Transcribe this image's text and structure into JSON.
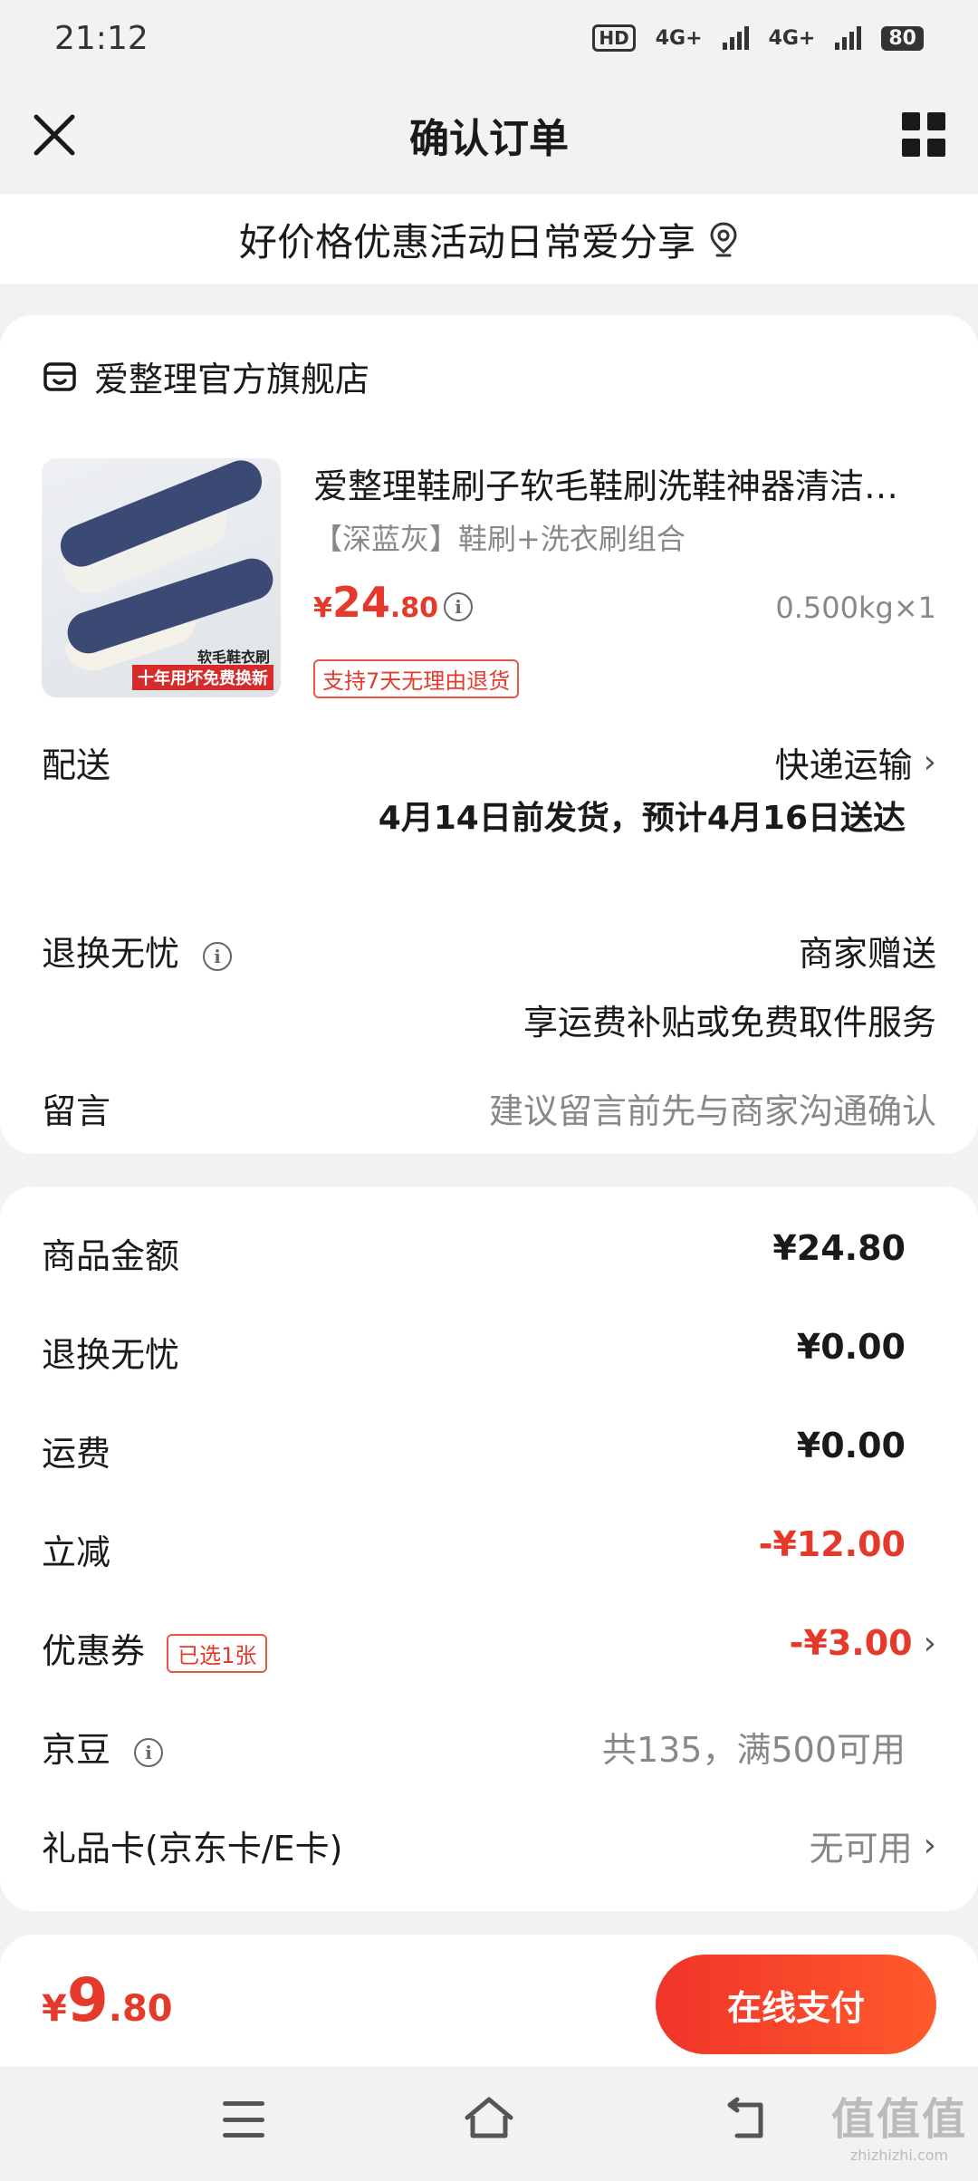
{
  "status_bar": {
    "time": "21:12",
    "hd": "HD",
    "net1": "4G+",
    "net2": "4G+",
    "battery": "80"
  },
  "header": {
    "title": "确认订单"
  },
  "promo_banner": {
    "text": "好价格优惠活动日常爱分享"
  },
  "store": {
    "name": "爱整理官方旗舰店"
  },
  "product": {
    "title": "爱整理鞋刷子软毛鞋刷洗鞋神器清洁…",
    "variant": "【深蓝灰】鞋刷+洗衣刷组合",
    "price_currency": "¥",
    "price_int": "24",
    "price_dec": ".80",
    "weight": "0.500kg×1",
    "badge": "支持7天无理由退货",
    "image_label_1": "软毛鞋衣刷",
    "image_label_2": "十年用坏免费换新"
  },
  "delivery": {
    "label": "配送",
    "method": "快递运输",
    "estimate": "4月14日前发货，预计4月16日送达"
  },
  "returns": {
    "label": "退换无忧",
    "value": "商家赠送",
    "desc": "享运费补贴或免费取件服务"
  },
  "message": {
    "label": "留言",
    "placeholder": "建议留言前先与商家沟通确认"
  },
  "summary": {
    "goods_label": "商品金额",
    "goods_value": "¥24.80",
    "returns_label": "退换无忧",
    "returns_value": "¥0.00",
    "shipping_label": "运费",
    "shipping_value": "¥0.00",
    "discount_label": "立减",
    "discount_value": "-¥12.00",
    "coupon_label": "优惠券",
    "coupon_tag": "已选1张",
    "coupon_value": "-¥3.00",
    "jd_bean_label": "京豆",
    "jd_bean_value": "共135，满500可用",
    "gift_card_label": "礼品卡(京东卡/E卡)",
    "gift_card_value": "无可用"
  },
  "footer": {
    "currency": "¥",
    "total_int": "9",
    "total_dec": ".80",
    "pay_label": "在线支付"
  },
  "watermark": {
    "main": "值值值",
    "sub": "zhizhizhi.com"
  },
  "colors": {
    "accent": "#e53a2b",
    "background": "#f2f2f2",
    "card": "#ffffff"
  },
  "icons": [
    "close-icon",
    "grid-menu-icon",
    "location-pin-icon",
    "store-icon",
    "info-icon",
    "chevron-right-icon",
    "menu-icon",
    "home-icon",
    "back-icon"
  ]
}
